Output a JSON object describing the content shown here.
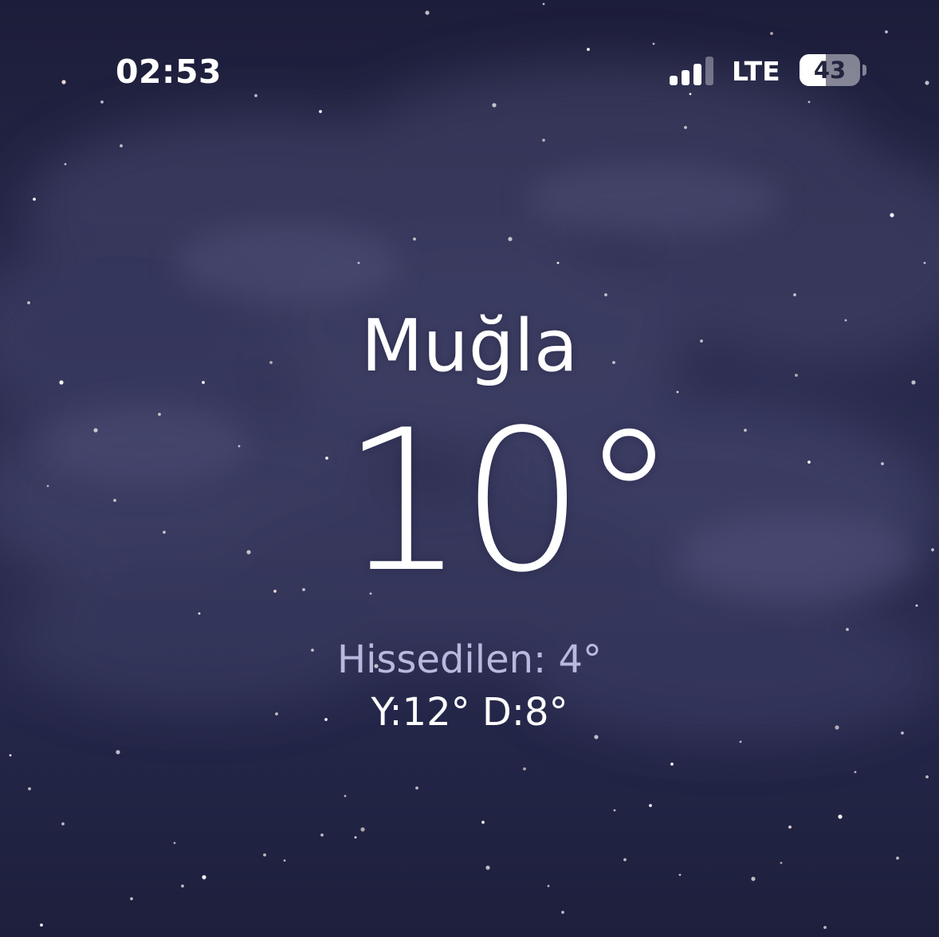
{
  "status_bar": {
    "time": "02:53",
    "signal_bars_active": 3,
    "signal_bars_total": 4,
    "network": "LTE",
    "battery_percent": 43,
    "battery_label": "43"
  },
  "weather": {
    "city": "Muğla",
    "temperature": "10°",
    "feels_like": "Hissedilen: 4°",
    "high_low": "Y:12° D:8°",
    "condition_icon": "night-cloudy-icon"
  },
  "colors": {
    "sky_top": "#1c1d39",
    "sky_middle": "#2b2d50",
    "sky_bottom": "#1d1f3c",
    "cloud": "#4a4a70",
    "feels_like_text": "#b9b8de",
    "primary_text": "#ffffff"
  }
}
